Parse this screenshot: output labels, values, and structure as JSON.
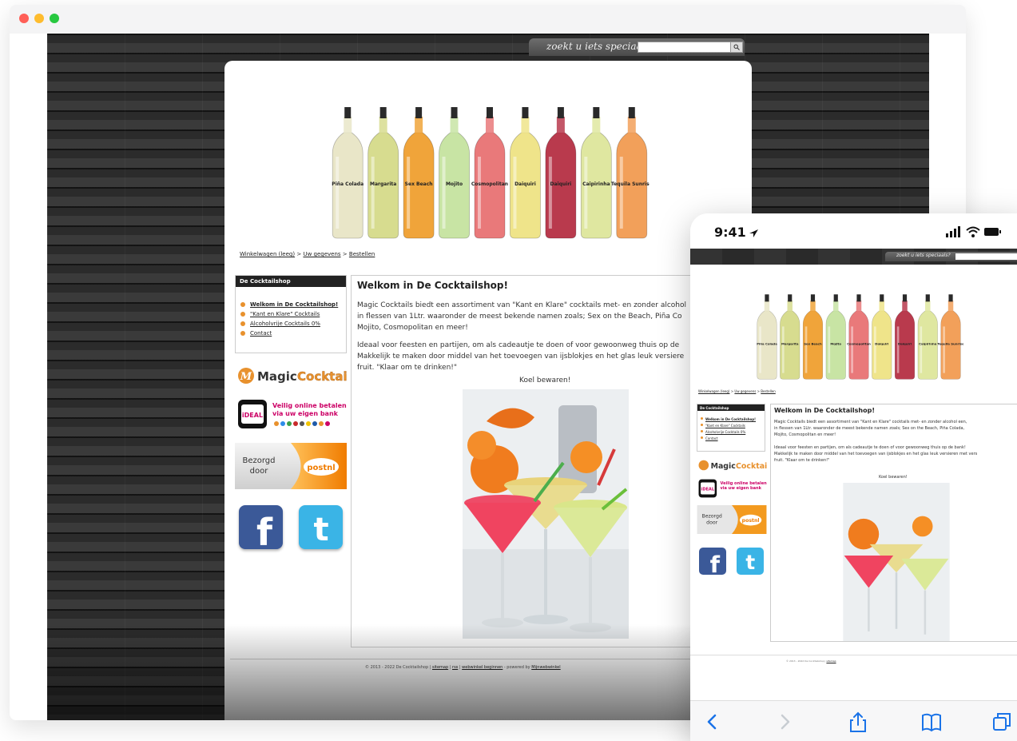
{
  "desktop": {
    "window_dots": [
      "#ff5f57",
      "#febc2e",
      "#28c840"
    ],
    "search": {
      "label": "zoekt u iets speciaals?",
      "value": "",
      "button_icon": "search-icon"
    },
    "banner": {
      "bottles": [
        {
          "label": "Piña Colada",
          "color": "#e9e6c8"
        },
        {
          "label": "Margarita",
          "color": "#d7dc8f"
        },
        {
          "label": "Sex Beach",
          "color": "#f0a43a"
        },
        {
          "label": "Mojito",
          "color": "#c8e4a4"
        },
        {
          "label": "Cosmopolitan",
          "color": "#e9797a"
        },
        {
          "label": "Daiquiri",
          "color": "#efe48a"
        },
        {
          "label": "Daiquiri",
          "color": "#b93a4d"
        },
        {
          "label": "Caipirinha",
          "color": "#dfe7a0"
        },
        {
          "label": "Tequila Sunrise",
          "color": "#f2a05a"
        }
      ]
    },
    "breadcrumb": {
      "cart": "Winkelwagen (leeg)",
      "sep1": ">",
      "details": "Uw gegevens",
      "sep2": ">",
      "order": "Bestellen"
    },
    "sidebar": {
      "title": "De Cocktailshop",
      "items": [
        {
          "label": "Welkom in De Cocktailshop!"
        },
        {
          "label": "\"Kant en Klare\" Cocktails"
        },
        {
          "label": "Alcoholvrije Cocktails 0%"
        },
        {
          "label": "Contact"
        }
      ]
    },
    "logos": {
      "magic_a": "Magic",
      "magic_b": "Cocktails",
      "ideal_badge": "iDEAL",
      "ideal_line1": "Veilig online betalen",
      "ideal_line2": "via uw eigen bank",
      "postnl_line1": "Bezorgd",
      "postnl_line2": "door",
      "postnl_badge": "postnl",
      "facebook_icon": "facebook-icon",
      "twitter_icon": "twitter-icon"
    },
    "content": {
      "title": "Welkom in De Cocktailshop!",
      "para1": [
        "Magic Cocktails biedt een assortiment van \"Kant en Klare\" cocktails met- en zonder alcohol",
        "in flessen van 1Ltr. waaronder de meest bekende namen zoals; Sex on the Beach, Piña Co",
        "Mojito, Cosmopolitan en meer!"
      ],
      "para2": [
        "Ideaal voor feesten en partijen, om als cadeautje te doen of voor gewoonweg thuis op de",
        "Makkelijk te maken door middel van het toevoegen van ijsblokjes en het glas leuk versiere",
        "fruit. \"Klaar om te drinken!\""
      ],
      "note": "Koel bewaren!"
    },
    "footer": {
      "text": "© 2013 - 2022 De Cocktailshop |",
      "sitemap": "sitemap",
      "sep1": "|",
      "rss": "rss",
      "sep2": "|",
      "webwinkel": "webwinkel beginnen",
      "powered": "- powered by",
      "mijnwebwinkel": "Mijnwebwinkel"
    }
  },
  "phone": {
    "time": "9:41",
    "search_label": "zoekt u iets speciaals?",
    "content": {
      "title": "Welkom in De Cocktailshop!",
      "para1": [
        "Magic Cocktails biedt een assortiment van \"Kant en Klare\" cocktails met- en zonder alcohol een,",
        "in flessen van 1Ltr. waaronder de meest bekende namen zoals; Sex on the Beach, Piña Colada,",
        "Mojito, Cosmopolitan en meer!"
      ],
      "para2": [
        "Ideaal voor feesten en partijen, om als cadeautje te doen of voor gewoonweg thuis op de bank!",
        "Makkelijk te maken door middel van het toevoegen van ijsblokjes en het glas leuk versieren met vers",
        "fruit. \"Klaar om te drinken!\""
      ],
      "note": "Koel bewaren!"
    },
    "sidebar": {
      "title": "De Cocktailshop",
      "items": [
        "Welkom in De Cocktailshop!",
        "\"Kant en Klare\" Cocktails",
        "Alcoholvrije Cocktails 0%",
        "Contact"
      ]
    },
    "toolbar_icons": [
      "back-icon",
      "forward-icon",
      "share-icon",
      "bookmarks-icon",
      "tabs-icon"
    ]
  }
}
